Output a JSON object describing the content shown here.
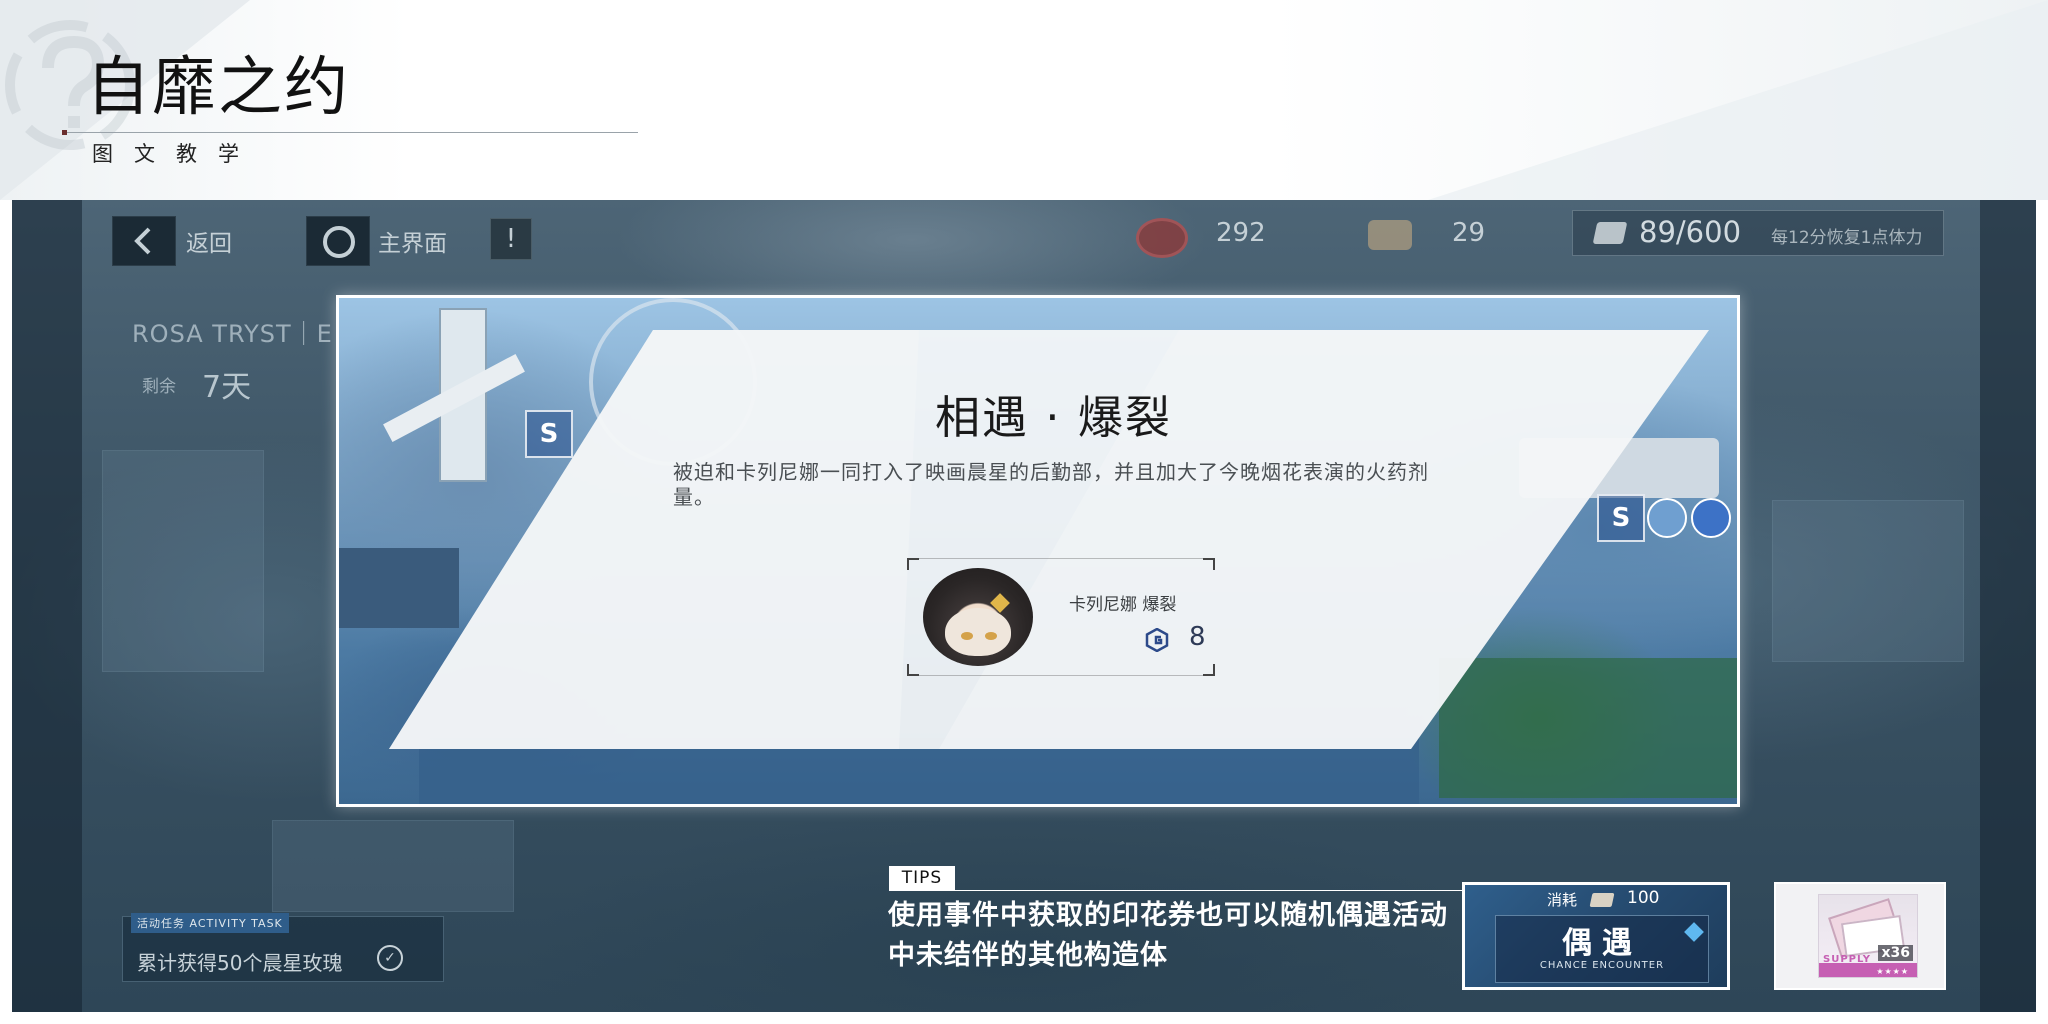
{
  "header": {
    "title": "自靡之约",
    "subtitle": "图文教学"
  },
  "game_ui": {
    "topbar": {
      "back_label": "返回",
      "home_label": "主界面",
      "info_icon": "info-icon",
      "resource_1_value": "292",
      "resource_2_value": "29",
      "stamina_value": "89/600",
      "stamina_note": "每12分恢复1点体力"
    },
    "event": {
      "name": "ROSA TRYST｜E",
      "remain_label": "剩余",
      "remain_value": "7天"
    },
    "task": {
      "tag": "活动任务 ACTIVITY TASK",
      "text": "累计获得50个晨星玫瑰"
    },
    "encounter": {
      "title": "相遇 · 爆裂",
      "description": "被迫和卡列尼娜一同打入了映画晨星的后勤部，并且加大了今晚烟花表演的火药剂量。",
      "character_name": "卡列尼娜 爆裂",
      "bond_value": "8"
    },
    "map_tags": {
      "tag_s": "S",
      "tag_s2": "S"
    },
    "tips": {
      "tag": "TIPS",
      "text": "使用事件中获取的印花券也可以随机偶遇活动中未结伴的其他构造体"
    },
    "encounter_button": {
      "cost_label": "消耗",
      "cost_value": "100",
      "label": "偶遇",
      "label_en": "CHANCE ENCOUNTER"
    },
    "supply_item": {
      "text": "SUPPLY",
      "quantity": "x36"
    }
  },
  "colors": {
    "accent_blue": "#2f5f8c",
    "panel_white": "#f4f6f7",
    "dark_bg": "#3c5566"
  }
}
